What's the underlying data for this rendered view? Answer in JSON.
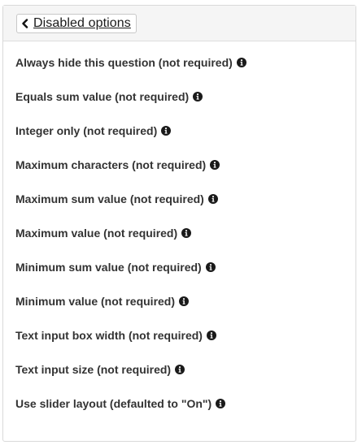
{
  "header": {
    "back_label": "Disabled options"
  },
  "options": [
    {
      "label": "Always hide this question (not required)",
      "icon": "info-circle-icon"
    },
    {
      "label": "Equals sum value (not required)",
      "icon": "info-circle-icon"
    },
    {
      "label": "Integer only (not required)",
      "icon": "info-circle-icon"
    },
    {
      "label": "Maximum characters (not required)",
      "icon": "info-circle-icon"
    },
    {
      "label": "Maximum sum value (not required)",
      "icon": "info-circle-icon"
    },
    {
      "label": "Maximum value (not required)",
      "icon": "info-circle-icon"
    },
    {
      "label": "Minimum sum value (not required)",
      "icon": "info-circle-icon"
    },
    {
      "label": "Minimum value (not required)",
      "icon": "info-circle-icon"
    },
    {
      "label": "Text input box width (not required)",
      "icon": "info-circle-icon"
    },
    {
      "label": "Text input size (not required)",
      "icon": "info-circle-icon"
    },
    {
      "label": "Use slider layout (defaulted to \"On\")",
      "icon": "info-circle-icon"
    }
  ],
  "colors": {
    "text": "#333333",
    "header_bg": "#f5f5f5",
    "border": "#d9d9d9",
    "icon": "#1a1a1a"
  }
}
